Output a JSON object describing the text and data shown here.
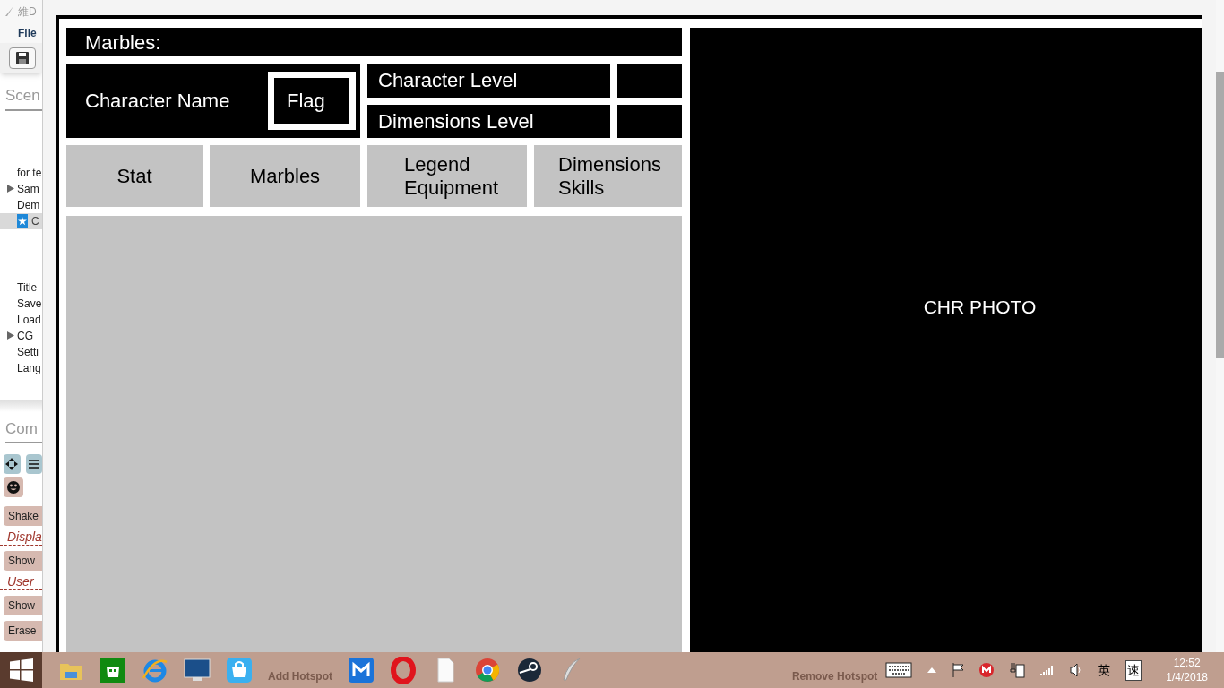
{
  "app_window": {
    "title": "維D",
    "menu": [
      "File"
    ]
  },
  "scene_panel": {
    "title": "Scen",
    "items": [
      {
        "label": "for te",
        "expandable": false,
        "selected": false,
        "starred": false
      },
      {
        "label": "Sam",
        "expandable": true,
        "selected": false,
        "starred": false
      },
      {
        "label": "Dem",
        "expandable": false,
        "selected": false,
        "starred": false
      },
      {
        "label": "C",
        "expandable": false,
        "selected": true,
        "starred": true
      },
      {
        "label": "Title",
        "expandable": false,
        "selected": false,
        "starred": false
      },
      {
        "label": "Save",
        "expandable": false,
        "selected": false,
        "starred": false
      },
      {
        "label": "Load",
        "expandable": false,
        "selected": false,
        "starred": false
      },
      {
        "label": "CG",
        "expandable": true,
        "selected": false,
        "starred": false
      },
      {
        "label": "Setti",
        "expandable": false,
        "selected": false,
        "starred": false
      },
      {
        "label": "Lang",
        "expandable": false,
        "selected": false,
        "starred": false
      }
    ]
  },
  "commands_panel": {
    "title": "Com",
    "items": [
      {
        "kind": "button",
        "label": "Shake"
      },
      {
        "kind": "section",
        "label": "Displa"
      },
      {
        "kind": "button",
        "label": "Show"
      },
      {
        "kind": "section",
        "label": "User"
      },
      {
        "kind": "button",
        "label": "Show"
      },
      {
        "kind": "button",
        "label": "Erase"
      }
    ]
  },
  "canvas": {
    "marbles_label": "Marbles:",
    "character_name": "Character Name",
    "flag": "Flag",
    "levels": [
      {
        "label": "Character Level"
      },
      {
        "label": "Dimensions Level"
      }
    ],
    "tabs": [
      {
        "label": "Stat"
      },
      {
        "label": "Marbles"
      },
      {
        "label": "Legend\nEquipment"
      },
      {
        "label": "Dimensions\nSkills"
      }
    ],
    "photo_label": "CHR PHOTO"
  },
  "taskbar": {
    "add_hotspot": "Add Hotspot",
    "remove_hotspot": "Remove Hotspot",
    "ime": [
      "英",
      "速"
    ],
    "time": "12:52",
    "date": "1/4/2018"
  }
}
